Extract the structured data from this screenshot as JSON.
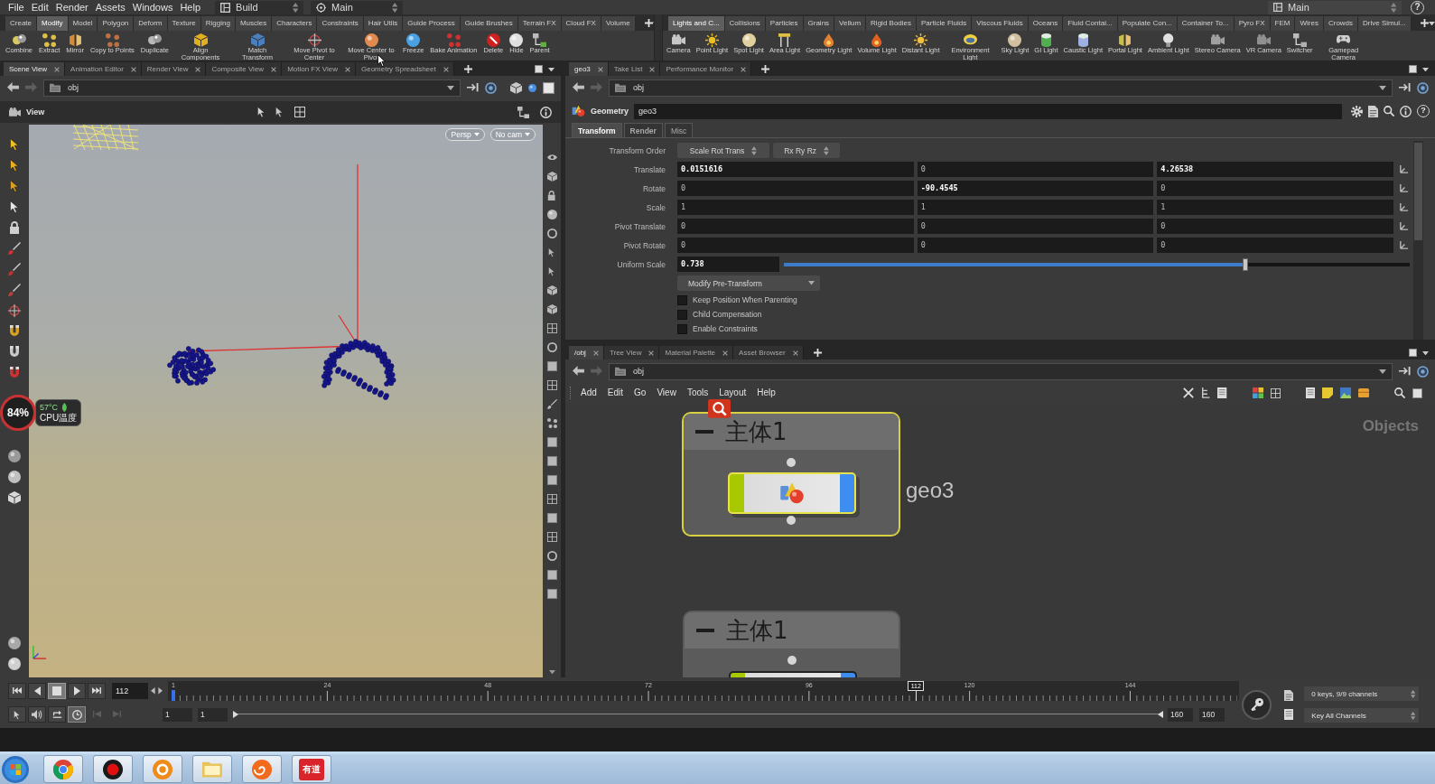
{
  "menu_bar": {
    "menus": [
      "File",
      "Edit",
      "Render",
      "Assets",
      "Windows",
      "Help"
    ],
    "desktop": "Build",
    "layout": "Main",
    "right_layout": "Main",
    "help": "?"
  },
  "shelf_left": {
    "tabs": [
      {
        "label": "Create",
        "selected": false
      },
      {
        "label": "Modify",
        "selected": true
      },
      {
        "label": "Model",
        "selected": false
      },
      {
        "label": "Polygon",
        "selected": false
      },
      {
        "label": "Deform",
        "selected": false
      },
      {
        "label": "Texture",
        "selected": false
      },
      {
        "label": "Rigging",
        "selected": false
      },
      {
        "label": "Muscles",
        "selected": false
      },
      {
        "label": "Characters",
        "selected": false
      },
      {
        "label": "Constraints",
        "selected": false
      },
      {
        "label": "Hair Utils",
        "selected": false
      },
      {
        "label": "Guide Process",
        "selected": false
      },
      {
        "label": "Guide Brushes",
        "selected": false
      },
      {
        "label": "Terrain FX",
        "selected": false
      },
      {
        "label": "Cloud FX",
        "selected": false
      },
      {
        "label": "Volume",
        "selected": false
      }
    ],
    "tools": [
      "Combine",
      "Extract",
      "Mirror",
      "Copy to Points",
      "Duplicate",
      "Align Components",
      "Match Transform",
      "Move Pivot to Center",
      "Move Center to Pivot",
      "Freeze",
      "Bake Animation",
      "Delete",
      "Hide",
      "Parent"
    ]
  },
  "shelf_right": {
    "tabs": [
      {
        "label": "Lights and C...",
        "selected": true
      },
      {
        "label": "Collisions",
        "selected": false
      },
      {
        "label": "Particles",
        "selected": false
      },
      {
        "label": "Grains",
        "selected": false
      },
      {
        "label": "Vellum",
        "selected": false
      },
      {
        "label": "Rigid Bodies",
        "selected": false
      },
      {
        "label": "Particle Fluids",
        "selected": false
      },
      {
        "label": "Viscous Fluids",
        "selected": false
      },
      {
        "label": "Oceans",
        "selected": false
      },
      {
        "label": "Fluid Contai...",
        "selected": false
      },
      {
        "label": "Populate Con...",
        "selected": false
      },
      {
        "label": "Container To...",
        "selected": false
      },
      {
        "label": "Pyro FX",
        "selected": false
      },
      {
        "label": "FEM",
        "selected": false
      },
      {
        "label": "Wires",
        "selected": false
      },
      {
        "label": "Crowds",
        "selected": false
      },
      {
        "label": "Drive Simul...",
        "selected": false
      }
    ],
    "tools": [
      "Camera",
      "Point Light",
      "Spot Light",
      "Area Light",
      "Geometry Light",
      "Volume Light",
      "Distant Light",
      "Environment Light",
      "Sky Light",
      "GI Light",
      "Caustic Light",
      "Portal Light",
      "Ambient Light",
      "Stereo Camera",
      "VR Camera",
      "Switcher",
      "Gamepad Camera"
    ]
  },
  "scene_pane": {
    "tabs": [
      {
        "label": "Scene View",
        "selected": true
      },
      {
        "label": "Animation Editor",
        "selected": false
      },
      {
        "label": "Render View",
        "selected": false
      },
      {
        "label": "Composite View",
        "selected": false
      },
      {
        "label": "Motion FX View",
        "selected": false
      },
      {
        "label": "Geometry Spreadsheet",
        "selected": false
      }
    ],
    "path": "obj",
    "view_menu": "View",
    "camera_menus": [
      "Persp",
      "No cam"
    ]
  },
  "cpu_widget": {
    "usage": "84%",
    "temperature": "57°C",
    "label": "CPU温度"
  },
  "parameter_pane": {
    "tabs": [
      {
        "label": "geo3",
        "selected": true
      },
      {
        "label": "Take List",
        "selected": false
      },
      {
        "label": "Performance Monitor",
        "selected": false
      }
    ],
    "path": "obj",
    "node_type": "Geometry",
    "node_name": "geo3",
    "help": "?",
    "param_tabs": [
      {
        "label": "Transform",
        "selected": true,
        "modified": true
      },
      {
        "label": "Render",
        "selected": false,
        "modified": true
      },
      {
        "label": "Misc",
        "selected": false,
        "modified": false
      }
    ],
    "transform_order": {
      "label": "Transform Order",
      "menus": [
        "Scale Rot Trans",
        "Rx Ry Rz"
      ]
    },
    "vectors": [
      {
        "label": "Translate",
        "values": [
          {
            "value": "0.0151616",
            "modified": true
          },
          {
            "value": "0",
            "modified": false
          },
          {
            "value": "4.26538",
            "modified": true
          }
        ]
      },
      {
        "label": "Rotate",
        "values": [
          {
            "value": "0",
            "modified": false
          },
          {
            "value": "-90.4545",
            "modified": true
          },
          {
            "value": "0",
            "modified": false
          }
        ]
      },
      {
        "label": "Scale",
        "values": [
          {
            "value": "1",
            "modified": false
          },
          {
            "value": "1",
            "modified": false
          },
          {
            "value": "1",
            "modified": false
          }
        ]
      },
      {
        "label": "Pivot Translate",
        "values": [
          {
            "value": "0",
            "modified": false
          },
          {
            "value": "0",
            "modified": false
          },
          {
            "value": "0",
            "modified": false
          }
        ]
      },
      {
        "label": "Pivot Rotate",
        "values": [
          {
            "value": "0",
            "modified": false
          },
          {
            "value": "0",
            "modified": false
          },
          {
            "value": "0",
            "modified": false
          }
        ]
      }
    ],
    "uniform_scale": {
      "label": "Uniform Scale",
      "value": "0.738",
      "modified": true,
      "level": 0.738
    },
    "pre_transform_menu": "Modify Pre-Transform",
    "toggles": [
      {
        "label": "Keep Position When Parenting",
        "checked": false
      },
      {
        "label": "Child Compensation",
        "checked": false
      },
      {
        "label": "Enable Constraints",
        "checked": false
      }
    ]
  },
  "network_pane": {
    "tabs": [
      {
        "label": "/obj",
        "selected": true
      },
      {
        "label": "Tree View",
        "selected": false
      },
      {
        "label": "Material Palette",
        "selected": false
      },
      {
        "label": "Asset Browser",
        "selected": false
      }
    ],
    "path": "obj",
    "menus": [
      "Add",
      "Edit",
      "Go",
      "View",
      "Tools",
      "Layout",
      "Help"
    ],
    "context": "Objects",
    "boxes": [
      {
        "title": "主体1",
        "expanded": true,
        "selected": true,
        "nodes": [
          {
            "name": "geo3",
            "selected": true
          }
        ]
      },
      {
        "title": "主体1",
        "expanded": true,
        "selected": false,
        "nodes": [
          {
            "selected": false
          }
        ]
      }
    ]
  },
  "timeline": {
    "transport": [
      {
        "kind": "first",
        "selected": false
      },
      {
        "kind": "reverse",
        "selected": false
      },
      {
        "kind": "stop",
        "selected": true
      },
      {
        "kind": "play",
        "selected": false
      },
      {
        "kind": "last",
        "selected": false
      }
    ],
    "frame": "112",
    "ruler_labels": [
      "1",
      "24",
      "48",
      "72",
      "96",
      "120",
      "144"
    ],
    "playhead": {
      "label": "112",
      "level": 0.698
    },
    "range": {
      "start": [
        "1",
        "1"
      ],
      "end": [
        "160",
        "160"
      ],
      "level": 1
    },
    "keys_status": "0 keys, 9/9 channels",
    "key_mode": "Key All Channels"
  },
  "taskbar": {
    "apps": [
      {
        "kind": "wheel"
      },
      {
        "kind": "record"
      },
      {
        "kind": "donut"
      },
      {
        "kind": "folder"
      },
      {
        "kind": "spiral"
      },
      {
        "kind": "tile",
        "label": "有道"
      }
    ]
  }
}
